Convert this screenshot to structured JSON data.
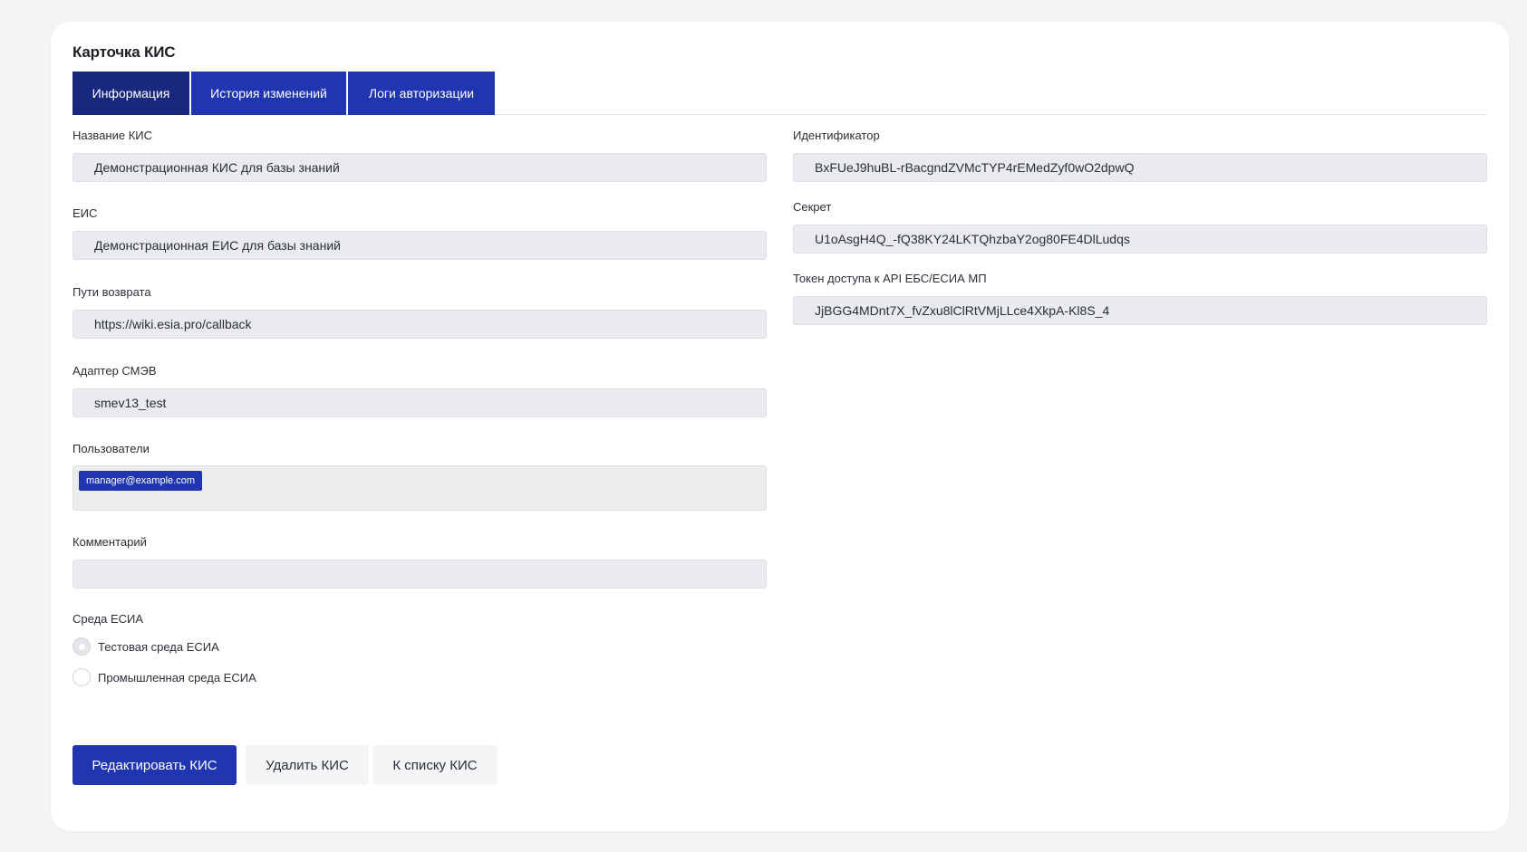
{
  "card": {
    "title": "Карточка КИС"
  },
  "tabs": [
    {
      "label": "Информация",
      "active": true
    },
    {
      "label": "История изменений",
      "active": false
    },
    {
      "label": "Логи авторизации",
      "active": false
    }
  ],
  "fields_left": {
    "name": {
      "label": "Название КИС",
      "value": "Демонстрационная КИС для базы знаний"
    },
    "eis": {
      "label": "ЕИС",
      "value": "Демонстрационная ЕИС для базы знаний"
    },
    "return_paths": {
      "label": "Пути возврата",
      "value": "https://wiki.esia.pro/callback"
    },
    "smev_adapter": {
      "label": "Адаптер СМЭВ",
      "value": "smev13_test"
    },
    "users": {
      "label": "Пользователи",
      "chips": [
        "manager@example.com"
      ]
    },
    "comment": {
      "label": "Комментарий",
      "value": ""
    }
  },
  "fields_right": {
    "identifier": {
      "label": "Идентификатор",
      "value": "BxFUeJ9huBL-rBacgndZVMcTYP4rEMedZyf0wO2dpwQ"
    },
    "secret": {
      "label": "Секрет",
      "value": "U1oAsgH4Q_-fQ38KY24LKTQhzbaY2og80FE4DlLudqs"
    },
    "api_token": {
      "label": "Токен доступа к API ЕБС/ЕСИА МП",
      "value": "JjBGG4MDnt7X_fvZxu8lClRtVMjLLce4XkpA-Kl8S_4"
    }
  },
  "environment": {
    "label": "Среда ЕСИА",
    "options": [
      {
        "label": "Тестовая среда ЕСИА",
        "selected": true
      },
      {
        "label": "Промышленная среда ЕСИА",
        "selected": false
      }
    ]
  },
  "actions": {
    "edit": "Редактировать КИС",
    "delete": "Удалить КИС",
    "to_list": "К списку КИС"
  },
  "colors": {
    "primary": "#2035b0",
    "tab_active": "#18287f",
    "input_bg": "#e9ebee",
    "page_bg": "#f3f4f6"
  }
}
